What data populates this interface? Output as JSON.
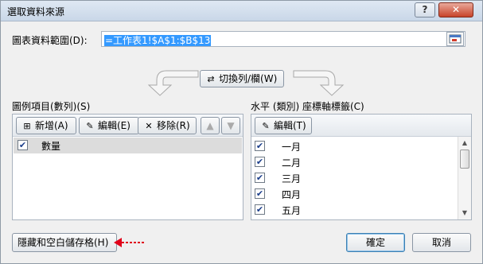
{
  "window": {
    "title": "選取資料來源",
    "help_label": "?",
    "close_label": "✕"
  },
  "range": {
    "label": "圖表資料範圍(D):",
    "value": "=工作表1!$A$1:$B$13"
  },
  "switch_button": {
    "label": "切換列/欄(W)"
  },
  "legend": {
    "label": "圖例項目(數列)(S)",
    "buttons": {
      "add": "新增(A)",
      "edit": "編輯(E)",
      "remove": "移除(R)"
    },
    "items": [
      {
        "label": "數量",
        "checked": true
      }
    ]
  },
  "axis": {
    "label": "水平 (類別) 座標軸標籤(C)",
    "edit_button": "編輯(T)",
    "items": [
      {
        "label": "一月",
        "checked": true
      },
      {
        "label": "二月",
        "checked": true
      },
      {
        "label": "三月",
        "checked": true
      },
      {
        "label": "四月",
        "checked": true
      },
      {
        "label": "五月",
        "checked": true
      }
    ]
  },
  "footer": {
    "hidden_cells_button": "隱藏和空白儲存格(H)",
    "ok_button": "確定",
    "cancel_button": "取消"
  },
  "colors": {
    "selection": "#3399ff",
    "annotation_arrow": "#e0001a"
  }
}
